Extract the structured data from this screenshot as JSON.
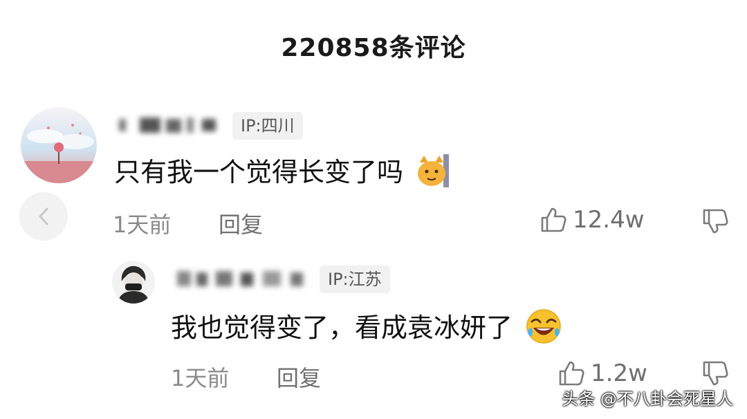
{
  "header": {
    "title": "220858条评论"
  },
  "comments": [
    {
      "ip": "IP:四川",
      "text": "只有我一个觉得长变了吗",
      "time": "1天前",
      "reply_label": "回复",
      "likes": "12.4w"
    },
    {
      "ip": "IP:江苏",
      "text": "我也觉得变了，看成袁冰妍了",
      "time": "1天前",
      "reply_label": "回复",
      "likes": "1.2w"
    }
  ],
  "watermark": "头条 @不八卦会死星人",
  "icons": {
    "back": "chevron-left-icon",
    "like": "thumbs-up-icon",
    "dislike": "thumbs-down-icon",
    "emoji1": "cat-emoji-icon",
    "emoji2": "laughing-emoji-icon"
  }
}
